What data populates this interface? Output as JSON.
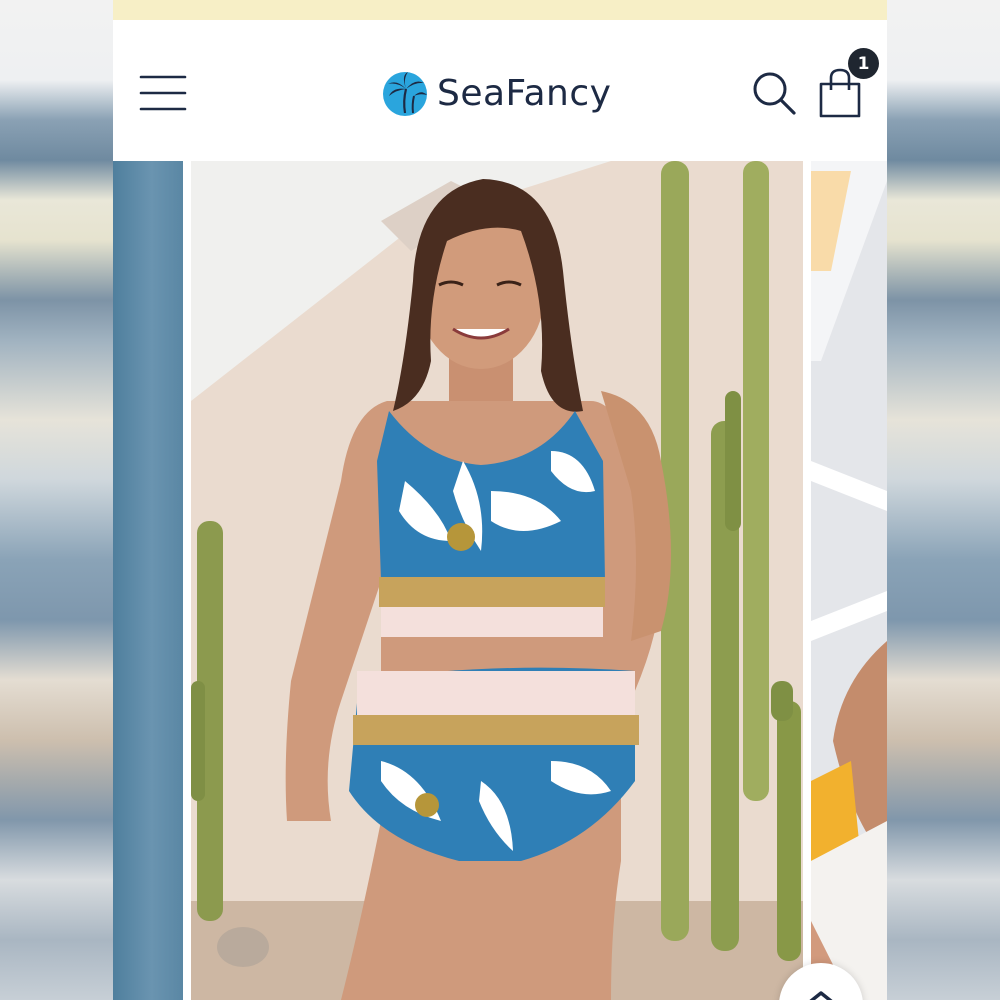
{
  "header": {
    "brand_name": "SeaFancy",
    "cart_count": "1"
  },
  "colors": {
    "announcement_bar": "#f7efc6",
    "header_background": "#ffffff",
    "brand_text": "#1d2a44",
    "logo_blue": "#2aa5dd",
    "cart_badge": "#1f2630"
  },
  "icons": {
    "menu": "hamburger-menu-icon",
    "logo": "palm-tree-logo-icon",
    "search": "search-icon",
    "cart": "shopping-bag-icon",
    "scroll_top": "chevron-up-icon"
  },
  "carousel": {
    "main_image": "model-wearing-floral-blue-two-piece-swimsuit-with-checkered-trim-beside-cactus"
  }
}
